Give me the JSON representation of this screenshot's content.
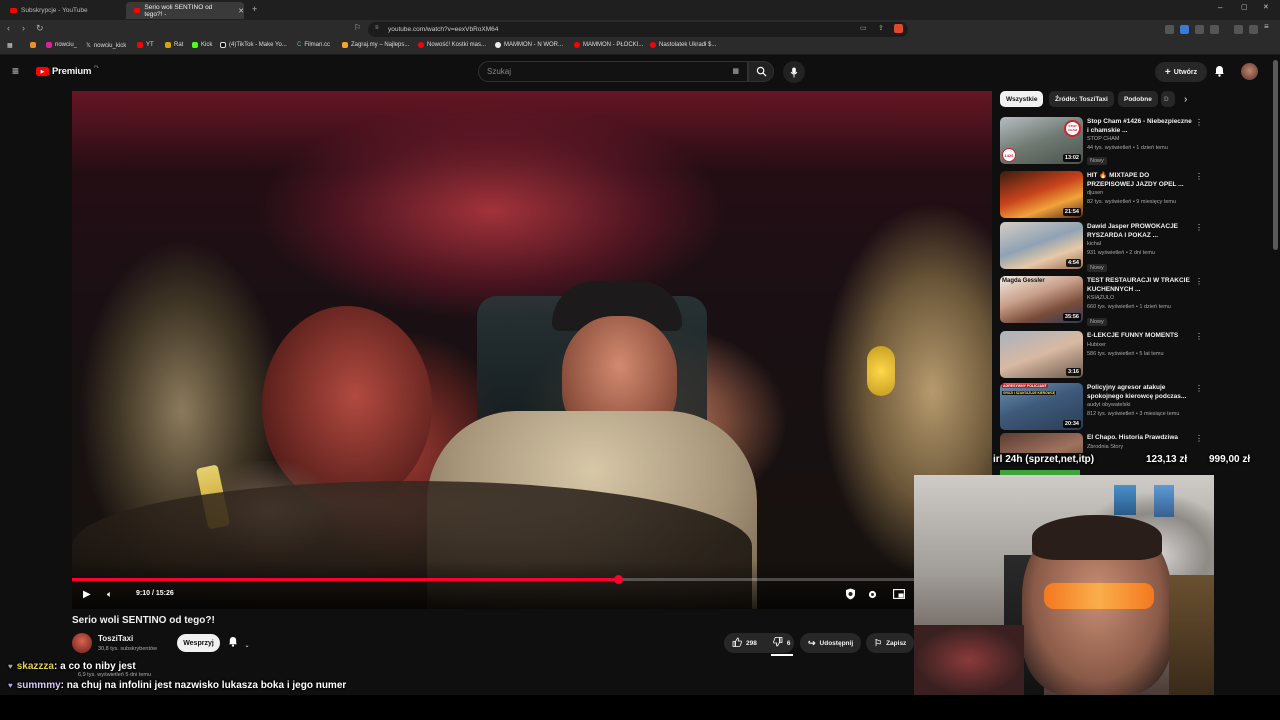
{
  "browser": {
    "tabs": [
      {
        "label": "Subskrypcje - YouTube",
        "active": false
      },
      {
        "label": "Serio woli SENTINO od tego?! -",
        "active": true
      }
    ],
    "url": "youtube.com/watch?v=eexVbRoXM64",
    "bookmarks": [
      "nowciu_",
      "nowciu_kick",
      "YT",
      "Rat",
      "Kick",
      "(4)TikTok - Make Yo...",
      "Filman.cc",
      "Zagraj.my – Najleps...",
      "Nowość! Kostki mas...",
      "MAMMON - N WOR...",
      "MAMMON - PŁOCKI...",
      "Nastolatek Ukradł $..."
    ]
  },
  "youtube": {
    "logo": "Premium",
    "logo_sup": "PL",
    "search_placeholder": "Szukaj",
    "create_label": "Utwórz"
  },
  "video": {
    "time": "9:10 / 15:26",
    "progress": 0.593,
    "title": "Serio woli SENTINO od tego?!",
    "channel": "TosziTaxi",
    "subscribers": "30,8 tys. subskrybentów",
    "join_label": "Wesprzyj",
    "likes": "298",
    "dislikes": "6",
    "share_label": "Udostępnij",
    "save_label": "Zapisz",
    "views_overlap": "6,9 tys. wyświetleń  5 dni temu"
  },
  "sidebar": {
    "chips": [
      "Wszystkie",
      "Źródło: TosziTaxi",
      "Podobne",
      "D"
    ],
    "recommendations": [
      {
        "title": "Stop Cham #1426 - Niebezpieczne i chamskie ...",
        "channel": "STOP CHAM",
        "meta": "44 tys. wyświetleń • 1 dzień temu",
        "badge": "Nowy",
        "duration": "13:02"
      },
      {
        "title": "HIT 🔥 MIXTAPE DO PRZEPISOWEJ JAZDY OPEL ...",
        "channel": "djusen",
        "meta": "82 tys. wyświetleń • 9 miesięcy temu",
        "badge": "",
        "duration": "21:54"
      },
      {
        "title": "Dawid Jasper PROWOKACJE RYSZARDA I POKAZ ...",
        "channel": "kichal",
        "meta": "931 wyświetleń • 2 dni temu",
        "badge": "Nowy",
        "duration": "4:54"
      },
      {
        "title": "TEST RESTAURACJI W TRAKCIE KUCHENNYCH ...",
        "channel": "KSIĄŻULO",
        "meta": "660 tys. wyświetleń • 1 dzień temu",
        "badge": "Nowy",
        "duration": "35:56"
      },
      {
        "title": "E-LEKCJE FUNNY MOMENTS",
        "channel": "Hubixer",
        "meta": "586 tys. wyświetleń • 5 lat temu",
        "badge": "",
        "duration": "3:16"
      },
      {
        "title": "Policyjny agresor atakuje spokojnego kierowcę podczas...",
        "channel": "audyt obywatelski",
        "meta": "812 tys. wyświetleń • 3 miesiące temu",
        "badge": "",
        "duration": "20:34"
      },
      {
        "title": "El Chapo. Historia Prawdziwa",
        "channel": "Zbrodnia Story",
        "meta": "",
        "badge": "",
        "duration": ""
      }
    ],
    "thumb_text": [
      "STOP CHAM",
      "1426",
      "Magda Gessler",
      "AGRESYWNY POLICJANT",
      "GROZI I SZANTAŻUJE KIEROWCĘ"
    ]
  },
  "overlay": {
    "donation_goal": "irl 24h (sprzet,net,itp)",
    "donation_current": "123,13 zł",
    "donation_target": "999,00 zł",
    "chat": [
      {
        "user": "skazzza",
        "message": ": a co to niby jest"
      },
      {
        "user": "summmy",
        "message": ": na chuj na infolini jest nazwisko lukasza boka i jego numer"
      }
    ]
  },
  "colors": {
    "accent": "#ff0033",
    "background": "#0f0f0f"
  }
}
